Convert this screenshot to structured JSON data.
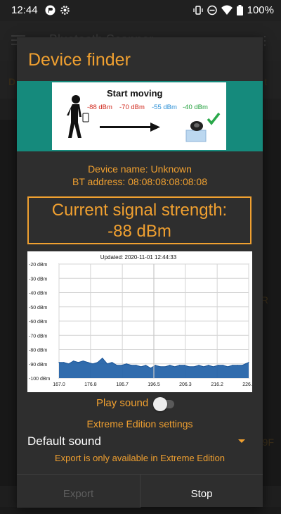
{
  "status_bar": {
    "time": "12:44",
    "battery": "100%",
    "icons": [
      "app-notification-icon",
      "settings-icon",
      "vibrate-icon",
      "do-not-disturb-icon",
      "wifi-icon",
      "battery-icon"
    ]
  },
  "background_app": {
    "title": "Bluetooth Scanner",
    "tab_left": "D",
    "tab_right": "t",
    "side_r": "R",
    "side_9f": "9F"
  },
  "dialog": {
    "title": "Device finder",
    "banner": {
      "heading": "Start moving",
      "readings": [
        "-88 dBm",
        "-70 dBm",
        "-55 dBm",
        "-40 dBm"
      ],
      "icons": [
        "person-icon",
        "arrow-icon",
        "device-icon",
        "checkmark-icon"
      ]
    },
    "device_name": "Device name: Unknown",
    "bt_address": "BT address: 08:08:08:08:08:08",
    "signal_label": "Current signal strength:",
    "signal_value": "-88 dBm",
    "play_sound_label": "Play sound",
    "play_sound_on": false,
    "extreme_settings_label": "Extreme Edition settings",
    "sound_selected": "Default sound",
    "export_note": "Export is only available in Extreme Edition",
    "buttons": {
      "export": "Export",
      "stop": "Stop"
    }
  },
  "chart_data": {
    "type": "area",
    "title": "Updated: 2020-11-01 12:44:33",
    "xlabel": "",
    "ylabel": "",
    "xlim": [
      167.0,
      226.0
    ],
    "ylim": [
      -100,
      -20
    ],
    "x_ticks": [
      "167.0",
      "176.8",
      "186.7",
      "196.5",
      "206.3",
      "216.2",
      "226.0"
    ],
    "y_ticks": [
      "-20 dBm",
      "-30 dBm",
      "-40 dBm",
      "-50 dBm",
      "-60 dBm",
      "-70 dBm",
      "-80 dBm",
      "-90 dBm",
      "-100 dBm"
    ],
    "grid": true,
    "colors": {
      "fill": "#1f5fa6",
      "line": "#1a5598"
    },
    "series": [
      {
        "x": [
          167.0,
          168.5,
          170.0,
          171.5,
          173.0,
          174.5,
          176.0,
          177.5,
          179.0,
          180.5,
          182.0,
          183.5,
          185.0,
          186.5,
          188.0,
          189.5,
          191.0,
          192.5,
          194.0,
          195.5,
          197.0,
          198.5,
          200.0,
          201.5,
          203.0,
          204.5,
          206.0,
          207.5,
          209.0,
          210.5,
          212.0,
          213.5,
          215.0,
          216.5,
          218.0,
          219.5,
          221.0,
          222.5,
          224.0,
          225.0,
          226.0
        ],
        "values": [
          -89,
          -89,
          -90,
          -88,
          -89,
          -88,
          -89,
          -90,
          -89,
          -86,
          -90,
          -89,
          -91,
          -91,
          -90,
          -91,
          -91,
          -92,
          -91,
          -93,
          -91,
          -92,
          -92,
          -91,
          -92,
          -91,
          -91,
          -92,
          -92,
          -91,
          -92,
          -91,
          -92,
          -91,
          -91,
          -92,
          -91,
          -91,
          -91,
          -90,
          -89
        ]
      }
    ]
  }
}
